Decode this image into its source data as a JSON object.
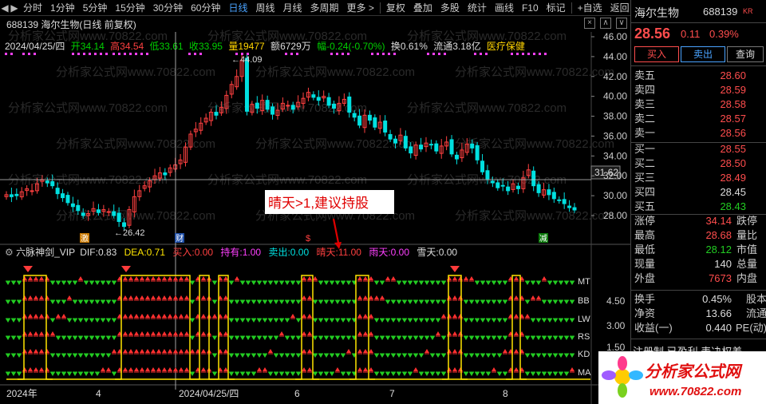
{
  "toolbar": {
    "items": [
      "分时",
      "1分钟",
      "5分钟",
      "15分钟",
      "30分钟",
      "60分钟",
      "日线",
      "周线",
      "月线",
      "多周期",
      "更多 >",
      "复权",
      "叠加",
      "多股",
      "统计",
      "画线",
      "F10",
      "标记",
      "+自选",
      "返回"
    ],
    "active": "日线"
  },
  "header": {
    "title": "688139 海尔生物(日线 前复权)"
  },
  "ohlc": {
    "date": "2024/04/25/四",
    "open_l": "开",
    "open": "34.14",
    "high_l": "高",
    "high": "34.54",
    "low_l": "低",
    "low": "33.61",
    "close_l": "收",
    "close": "33.95",
    "vol_l": "量",
    "vol": "19477",
    "amt_l": "额",
    "amt": "6729万",
    "amp_l": "幅",
    "amp": "-0.24(-0.70%)",
    "turn": "换0.61%",
    "float": "流通3.18亿",
    "sector": "医疗保健"
  },
  "axis": {
    "price_ticks": [
      "46.00",
      "44.00",
      "42.00",
      "40.00",
      "38.00",
      "36.00",
      "34.00",
      "32.00",
      "30.00",
      "28.00"
    ],
    "cursor_price": "31.62",
    "sub_ticks": [
      "4.50",
      "3.00",
      "1.50"
    ],
    "dates": [
      "2024年",
      "4",
      "2024/04/25/四",
      "6",
      "7",
      "8"
    ]
  },
  "annotations": {
    "high": "44.09",
    "low": "26.42",
    "callout": "晴天>1,建议持股",
    "tag1": "激",
    "tag2": "财",
    "tag3": "$",
    "tag4": "减"
  },
  "indicator": {
    "name": "六脉神剑_VIP",
    "dif_l": "DIF:",
    "dif": "0.83",
    "dea_l": "DEA:",
    "dea": "0.71",
    "buy_l": "买入:",
    "buy": "0.00",
    "hold_l": "持有:",
    "hold": "1.00",
    "sell_l": "卖出:",
    "sell": "0.00",
    "sunny_l": "晴天:",
    "sunny": "11.00",
    "rain_l": "雨天:",
    "rain": "0.00",
    "snow_l": "雪天:",
    "snow": "0.00",
    "rows": [
      "MT",
      "BB",
      "LW",
      "RS",
      "KD",
      "MA"
    ]
  },
  "quote": {
    "name": "海尔生物",
    "code": "688139",
    "badge": "KR",
    "price": "28.56",
    "change": "0.11",
    "change_pct": "0.39%",
    "buttons": [
      "买入",
      "卖出",
      "查询"
    ],
    "sells": [
      [
        "卖五",
        "28.60"
      ],
      [
        "卖四",
        "28.59"
      ],
      [
        "卖三",
        "28.58"
      ],
      [
        "卖二",
        "28.57"
      ],
      [
        "卖一",
        "28.56"
      ]
    ],
    "buys": [
      [
        "买一",
        "28.55"
      ],
      [
        "买二",
        "28.50"
      ],
      [
        "买三",
        "28.49"
      ],
      [
        "买四",
        "28.45"
      ],
      [
        "买五",
        "28.43"
      ]
    ],
    "stats1": [
      [
        "涨停",
        "34.14",
        "跌停"
      ],
      [
        "最高",
        "28.68",
        "量比"
      ],
      [
        "最低",
        "28.12",
        "市值"
      ],
      [
        "现量",
        "140",
        "总量"
      ],
      [
        "外盘",
        "7673",
        "内盘"
      ]
    ],
    "stats2": [
      [
        "换手",
        "0.45%",
        "股本"
      ],
      [
        "净资",
        "13.66",
        "流通"
      ],
      [
        "收益(一)",
        "0.440",
        "PE(动)"
      ]
    ],
    "tags": "注册制 已盈利 表决权差"
  },
  "watermark": "分析家公式网www.70822.com",
  "logo": {
    "text1": "分析家公式网",
    "text2": "www.70822.com"
  },
  "colors": {
    "up": "#ff4040",
    "down": "#00e0e0",
    "accent": "#4aa3ff",
    "yellow": "#ffe600",
    "magenta": "#ff40ff"
  }
}
